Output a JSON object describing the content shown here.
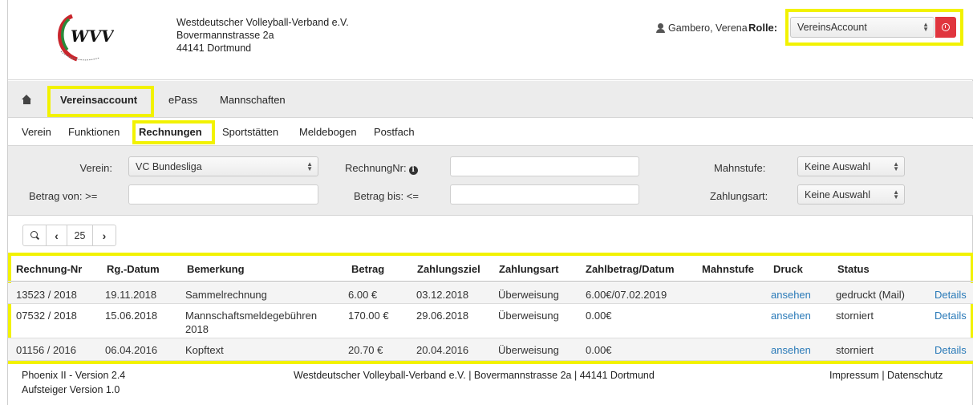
{
  "org": {
    "name": "Westdeutscher Volleyball-Verband e.V.",
    "street": "Bovermannstrasse 2a",
    "city": "44141 Dortmund",
    "logo_text": "WVV"
  },
  "user": {
    "name": "Gambero, Verena",
    "role_label": "Rolle:",
    "role_value": "VereinsAccount"
  },
  "mainnav": {
    "items": [
      "Vereinsaccount",
      "ePass",
      "Mannschaften"
    ]
  },
  "subnav": {
    "items": [
      "Verein",
      "Funktionen",
      "Rechnungen",
      "Sportstätten",
      "Meldebogen",
      "Postfach"
    ]
  },
  "filter": {
    "verein_label": "Verein:",
    "verein_value": "VC Bundesliga",
    "rechnungnr_label": "RechnungNr:",
    "rechnungnr_value": "",
    "mahnstufe_label": "Mahnstufe:",
    "mahnstufe_value": "Keine Auswahl",
    "betrag_von_label": "Betrag von: >=",
    "betrag_von_value": "",
    "betrag_bis_label": "Betrag bis: <=",
    "betrag_bis_value": "",
    "zahlungsart_label": "Zahlungsart:",
    "zahlungsart_value": "Keine Auswahl"
  },
  "pager": {
    "page_size": "25"
  },
  "table": {
    "headers": [
      "Rechnung-Nr",
      "Rg.-Datum",
      "Bemerkung",
      "Betrag",
      "Zahlungsziel",
      "Zahlungsart",
      "Zahlbetrag/Datum",
      "Mahnstufe",
      "Druck",
      "Status"
    ],
    "rows": [
      {
        "nr": "13523 / 2018",
        "datum": "19.11.2018",
        "bemerkung": "Sammelrechnung",
        "betrag": "6.00 €",
        "ziel": "03.12.2018",
        "art": "Überweisung",
        "zahlbetrag": "6.00€/07.02.2019",
        "mahnstufe": "",
        "druck": "ansehen",
        "status": "gedruckt (Mail)",
        "details": "Details"
      },
      {
        "nr": "07532 / 2018",
        "datum": "15.06.2018",
        "bemerkung": "Mannschaftsmeldegebühren 2018",
        "betrag": "170.00 €",
        "ziel": "29.06.2018",
        "art": "Überweisung",
        "zahlbetrag": "0.00€",
        "mahnstufe": "",
        "druck": "ansehen",
        "status": "storniert",
        "details": "Details"
      },
      {
        "nr": "01156 / 2016",
        "datum": "06.04.2016",
        "bemerkung": "Kopftext",
        "betrag": "20.70 €",
        "ziel": "20.04.2016",
        "art": "Überweisung",
        "zahlbetrag": "0.00€",
        "mahnstufe": "",
        "druck": "ansehen",
        "status": "storniert",
        "details": "Details"
      }
    ]
  },
  "footer": {
    "version": "Phoenix II - Version 2.4",
    "aufsteiger": "Aufsteiger Version 1.0",
    "center": "Westdeutscher Volleyball-Verband e.V. | Bovermannstrasse 2a | 44141 Dortmund",
    "impressum": "Impressum",
    "separator": "|",
    "datenschutz": "Datenschutz"
  },
  "colors": {
    "highlight": "#f2f200",
    "logout": "#e0353e",
    "link": "#2a7ab8",
    "nav_bg": "#ececec"
  }
}
